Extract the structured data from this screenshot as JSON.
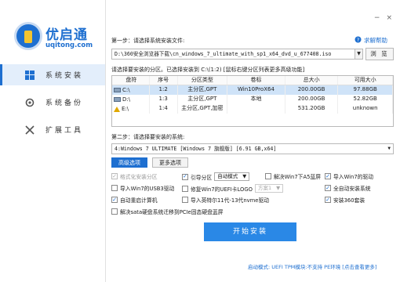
{
  "brand": {
    "title": "优启通",
    "subtitle": "uqitong.com"
  },
  "sidebar": {
    "items": [
      {
        "label": "系统安装",
        "icon": "windows-icon"
      },
      {
        "label": "系统备份",
        "icon": "backup-icon"
      },
      {
        "label": "扩展工具",
        "icon": "tools-icon"
      }
    ]
  },
  "window": {
    "min": "−",
    "close": "×"
  },
  "step1": {
    "label": "第一步：请选择系统安装文件:",
    "help": "求解帮助",
    "path": "D:\\360安全浏览器下载\\cn_windows_7_ultimate_with_sp1_x64_dvd_u_677408.iso",
    "browse": "浏 览"
  },
  "partition": {
    "label": "请选择要安装的分区。已选择安装到 C:\\(1:2) [鼠标右键分区列表更多高级功能]",
    "columns": [
      "盘符",
      "序号",
      "分区类型",
      "卷标",
      "总大小",
      "可用大小"
    ],
    "rows": [
      {
        "drive": "C:\\",
        "index": "1:2",
        "type": "主分区,GPT",
        "label": "Win10ProX64",
        "total": "200.00GB",
        "free": "97.88GB"
      },
      {
        "drive": "D:\\",
        "index": "1:3",
        "type": "主分区,GPT",
        "label": "本地",
        "total": "200.00GB",
        "free": "52.82GB"
      },
      {
        "drive": "E:\\",
        "index": "1:4",
        "type": "主分区,GPT,加密",
        "label": "",
        "total": "531.20GB",
        "free": "unknown"
      }
    ]
  },
  "step2": {
    "label": "第二步：请选择要安装的系统:",
    "selection": "4:Windows 7 ULTIMATE [Windows 7 旗舰版] [6.91 GB,x64]"
  },
  "tabs": [
    "高级选项",
    "更多选项"
  ],
  "options": {
    "format": "格式化安装分区",
    "boot": "引导分区",
    "boot_mode": "自动模式",
    "win7_sata": "解决Win7下A5蓝屏",
    "import_win7_driver": "导入Win7的驱动",
    "import_usb3": "导入Win7的USB3驱动",
    "fix_win7_uefi": "修复Win7的UEFI卡LOGO",
    "fix_option": "方案1",
    "auto_activate": "全自动安装系统",
    "auto_reboot": "自动重启计算机",
    "import_intel": "导入英特尔11代-13代nvme驱动",
    "install_360": "安装360套装",
    "sata_fix": "解决sata硬盘系统迁移到PCIe固态硬盘蓝屏"
  },
  "install_button": "开始安装",
  "status": {
    "boot_mode_label": "启动模式:",
    "boot_mode_value": "UEFI",
    "tpm_label": "TPM模块:",
    "tpm_value": "不支持",
    "pe_label": "PE环境",
    "more": "[点击查看更多]"
  },
  "colors": {
    "accent": "#1e6fd0",
    "button": "#2a88e6",
    "selected_row": "#cfe3f8"
  }
}
